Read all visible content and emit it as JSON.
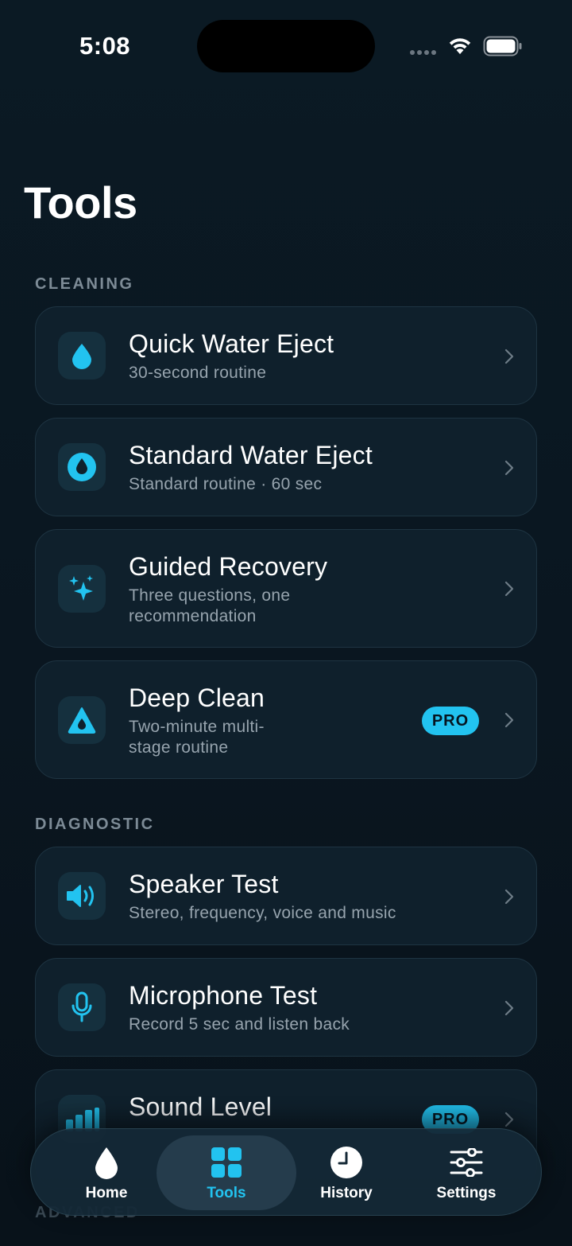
{
  "status": {
    "time": "5:08"
  },
  "page": {
    "title": "Tools"
  },
  "sections": {
    "cleaning": "CLEANING",
    "diagnostic": "DIAGNOSTIC",
    "advanced": "ADVANCED"
  },
  "cards": {
    "quick": {
      "title": "Quick Water Eject",
      "subtitle": "30-second routine",
      "icon": "water-drop-icon"
    },
    "standard": {
      "title": "Standard Water Eject",
      "subtitle": "Standard routine · 60 sec",
      "icon": "water-drop-circle-icon"
    },
    "guided": {
      "title": "Guided Recovery",
      "subtitle": "Three questions, one recommendation",
      "icon": "sparkles-icon"
    },
    "deep": {
      "title": "Deep Clean",
      "subtitle": "Two-minute multi-stage routine",
      "badge": "PRO",
      "icon": "drop-triangle-icon"
    },
    "speaker": {
      "title": "Speaker Test",
      "subtitle": "Stereo, frequency, voice and music",
      "icon": "speaker-icon"
    },
    "mic": {
      "title": "Microphone Test",
      "subtitle": "Record 5 sec and listen back",
      "icon": "microphone-icon"
    },
    "sound": {
      "title": "Sound Level",
      "badge": "PRO",
      "icon": "bar-chart-icon"
    }
  },
  "tabs": {
    "home": "Home",
    "tools": "Tools",
    "history": "History",
    "settings": "Settings"
  },
  "colors": {
    "accent": "#22c3f0",
    "background": "#0a1620",
    "card": "#0f202c"
  }
}
